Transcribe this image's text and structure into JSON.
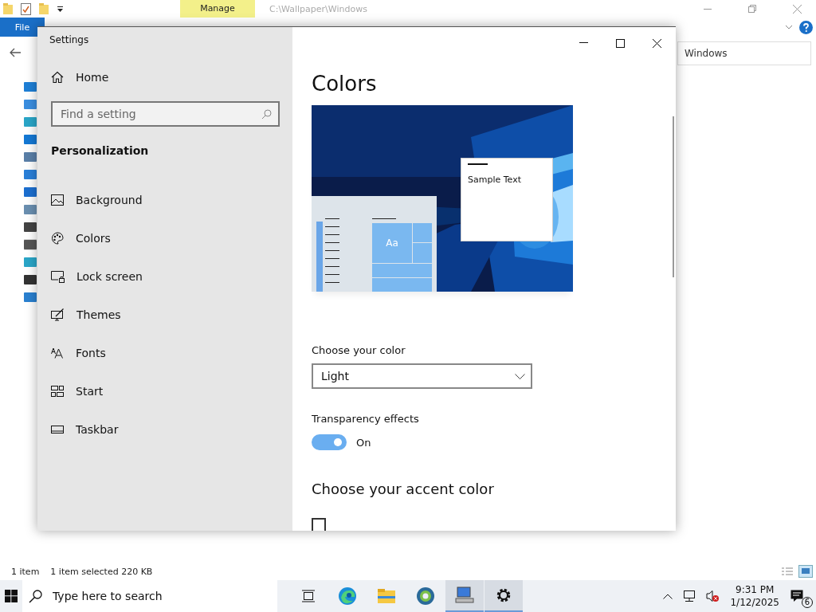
{
  "explorer": {
    "ribbon_tab": "Manage",
    "path": "C:\\Wallpaper\\Windows",
    "file_tab": "File",
    "search_value": "Windows",
    "status_bar": {
      "count": "1 item",
      "selection": "1 item selected  220 KB"
    }
  },
  "settings": {
    "window": {
      "title": "Settings"
    },
    "sidebar": {
      "home": "Home",
      "search": {
        "placeholder": "Find a setting"
      },
      "section": "Personalization",
      "items": [
        {
          "label": "Background",
          "kind": "background"
        },
        {
          "label": "Colors",
          "kind": "colors"
        },
        {
          "label": "Lock screen",
          "kind": "lock"
        },
        {
          "label": "Themes",
          "kind": "themes"
        },
        {
          "label": "Fonts",
          "kind": "fonts"
        },
        {
          "label": "Start",
          "kind": "start"
        },
        {
          "label": "Taskbar",
          "kind": "taskbar"
        }
      ]
    },
    "page": {
      "title": "Colors",
      "preview": {
        "tile_text": "Aa",
        "sample_text": "Sample Text"
      },
      "color_label": "Choose your color",
      "color_value": "Light",
      "transparency": {
        "label": "Transparency effects",
        "on": true,
        "state_text": "On"
      },
      "accent_title": "Choose your accent color",
      "auto_accent": {
        "checked": false
      }
    }
  },
  "taskbar": {
    "search": {
      "placeholder": "Type here to search"
    },
    "apps": [
      {
        "kind": "taskview",
        "active": false
      },
      {
        "kind": "edge",
        "active": false
      },
      {
        "kind": "explorer",
        "active": false
      },
      {
        "kind": "globe",
        "active": false
      },
      {
        "kind": "remote",
        "active": true
      },
      {
        "kind": "settings",
        "active": true
      }
    ],
    "time": "9:31 PM",
    "date": "1/12/2025",
    "notifications": "6"
  }
}
